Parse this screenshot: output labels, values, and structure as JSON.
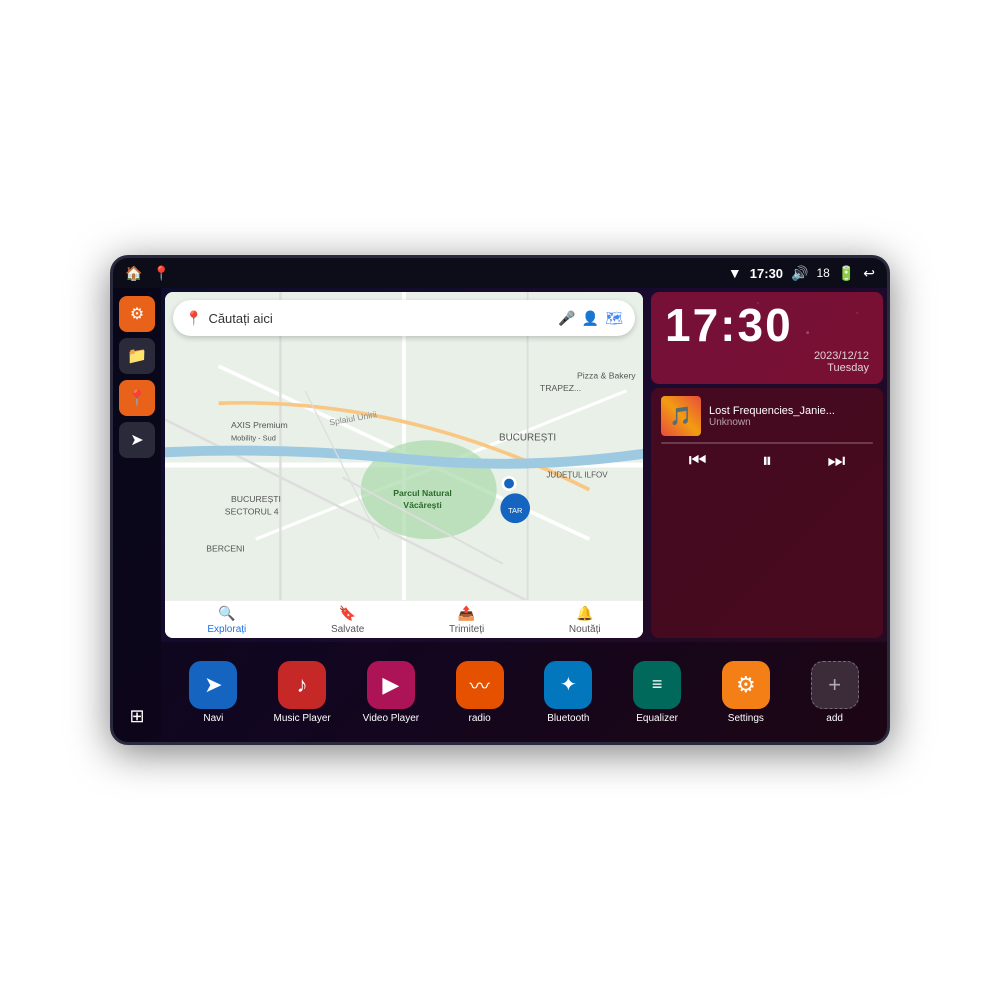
{
  "device": {
    "border_color": "#2a2a3e"
  },
  "status_bar": {
    "left_icons": [
      "🏠",
      "📍"
    ],
    "wifi_icon": "▼",
    "time": "17:30",
    "volume_icon": "🔊",
    "battery_num": "18",
    "battery_icon": "🔋",
    "back_icon": "↩"
  },
  "sidebar": {
    "buttons": [
      {
        "icon": "⚙",
        "style": "orange",
        "name": "settings"
      },
      {
        "icon": "📁",
        "style": "dark",
        "name": "files"
      },
      {
        "icon": "📍",
        "style": "orange",
        "name": "maps"
      },
      {
        "icon": "➤",
        "style": "dark",
        "name": "navigation"
      },
      {
        "icon": "⊞",
        "style": "grid",
        "name": "grid"
      }
    ]
  },
  "map": {
    "search_placeholder": "Căutați aici",
    "bottom_tabs": [
      {
        "label": "Explorați",
        "icon": "🔍",
        "active": true
      },
      {
        "label": "Salvate",
        "icon": "🔖",
        "active": false
      },
      {
        "label": "Trimiteți",
        "icon": "📤",
        "active": false
      },
      {
        "label": "Noutăți",
        "icon": "🔔",
        "active": false
      }
    ],
    "places": [
      "Parcul Natural Văcărești",
      "AXIS Premium Mobility - Sud",
      "Pizza & Bakery",
      "BUCUREȘTI",
      "BUCUREȘTI SECTORUL 4",
      "JUDEȚUL ILFOV",
      "BERCENI"
    ]
  },
  "clock": {
    "time": "17:30",
    "date": "2023/12/12",
    "day": "Tuesday"
  },
  "music": {
    "title": "Lost Frequencies_Janie...",
    "artist": "Unknown",
    "controls": {
      "prev": "⏮",
      "play_pause": "⏸",
      "next": "⏭"
    }
  },
  "apps": [
    {
      "label": "Navi",
      "icon": "➤",
      "style": "icon-blue"
    },
    {
      "label": "Music Player",
      "icon": "♪",
      "style": "icon-red"
    },
    {
      "label": "Video Player",
      "icon": "▶",
      "style": "icon-pink"
    },
    {
      "label": "radio",
      "icon": "📻",
      "style": "icon-orange"
    },
    {
      "label": "Bluetooth",
      "icon": "✦",
      "style": "icon-cyan"
    },
    {
      "label": "Equalizer",
      "icon": "≡",
      "style": "icon-teal"
    },
    {
      "label": "Settings",
      "icon": "⚙",
      "style": "icon-amber"
    },
    {
      "label": "add",
      "icon": "+",
      "style": "icon-gray"
    }
  ]
}
